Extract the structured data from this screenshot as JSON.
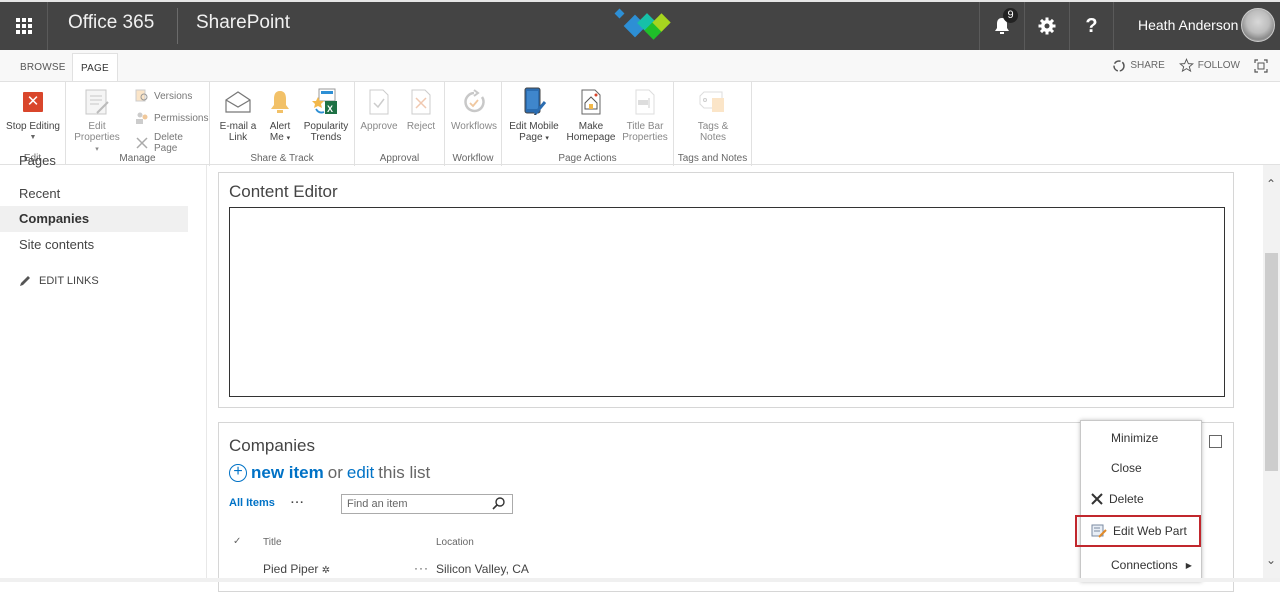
{
  "suitebar": {
    "brand": "Office 365",
    "app": "SharePoint",
    "notifications_count": "9",
    "user_name": "Heath Anderson",
    "colors": {
      "bg": "#444444",
      "logo_blue": "#2d8fd5",
      "logo_teal": "#16c0a8",
      "logo_green": "#1fbf2a",
      "logo_lime": "#a6d51f"
    }
  },
  "ribbon": {
    "tabs": [
      {
        "label": "BROWSE"
      },
      {
        "label": "PAGE",
        "selected": true
      }
    ],
    "actions": {
      "share": "SHARE",
      "follow": "FOLLOW"
    },
    "groups": [
      {
        "label": "Edit",
        "buttons": [
          {
            "label": "Stop Editing",
            "icon": "close-x-icon"
          }
        ]
      },
      {
        "label": "Manage",
        "buttons": [
          {
            "label": "Edit Properties",
            "icon": "edit-properties-icon"
          },
          {
            "label": "Versions",
            "icon": "versions-icon"
          },
          {
            "label": "Permissions",
            "icon": "permissions-icon"
          },
          {
            "label": "Delete Page",
            "icon": "delete-icon"
          }
        ]
      },
      {
        "label": "Share & Track",
        "buttons": [
          {
            "label_line1": "E-mail a",
            "label_line2": "Link",
            "icon": "envelope-icon"
          },
          {
            "label_line1": "Alert",
            "label_line2": "Me",
            "icon": "bell-icon"
          },
          {
            "label_line1": "Popularity",
            "label_line2": "Trends",
            "icon": "excel-icon"
          }
        ]
      },
      {
        "label": "Approval",
        "buttons": [
          {
            "label": "Approve",
            "icon": "approve-icon"
          },
          {
            "label": "Reject",
            "icon": "reject-icon"
          }
        ]
      },
      {
        "label": "Workflow",
        "buttons": [
          {
            "label": "Workflows",
            "icon": "workflow-icon"
          }
        ]
      },
      {
        "label": "Page Actions",
        "buttons": [
          {
            "label_line1": "Edit Mobile",
            "label_line2": "Page",
            "icon": "mobile-icon"
          },
          {
            "label_line1": "Make",
            "label_line2": "Homepage",
            "icon": "home-page-icon"
          },
          {
            "label_line1": "Title Bar",
            "label_line2": "Properties",
            "icon": "title-bar-icon"
          }
        ]
      },
      {
        "label": "Tags and Notes",
        "buttons": [
          {
            "label_line1": "Tags &",
            "label_line2": "Notes",
            "icon": "tag-icon"
          }
        ]
      }
    ]
  },
  "leftnav": {
    "items": [
      {
        "label": "Pages"
      },
      {
        "label": "Recent"
      },
      {
        "label": "Companies",
        "selected": true
      },
      {
        "label": "Site contents"
      }
    ],
    "edit_links": "EDIT LINKS"
  },
  "main": {
    "content_editor": {
      "title": "Content Editor"
    },
    "companies_webpart": {
      "title": "Companies",
      "new_item": "new item",
      "or": "or",
      "edit": "edit",
      "this_list": "this list",
      "view": "All Items",
      "search_placeholder": "Find an item",
      "columns": [
        "Title",
        "Location"
      ],
      "rows": [
        {
          "title": "Pied Piper",
          "location": "Silicon Valley, CA"
        }
      ]
    }
  },
  "context_menu": {
    "items": [
      {
        "label": "Minimize"
      },
      {
        "label": "Close"
      },
      {
        "label": "Delete"
      },
      {
        "label": "Edit Web Part",
        "highlighted": true
      },
      {
        "label": "Connections",
        "submenu": true
      }
    ]
  }
}
